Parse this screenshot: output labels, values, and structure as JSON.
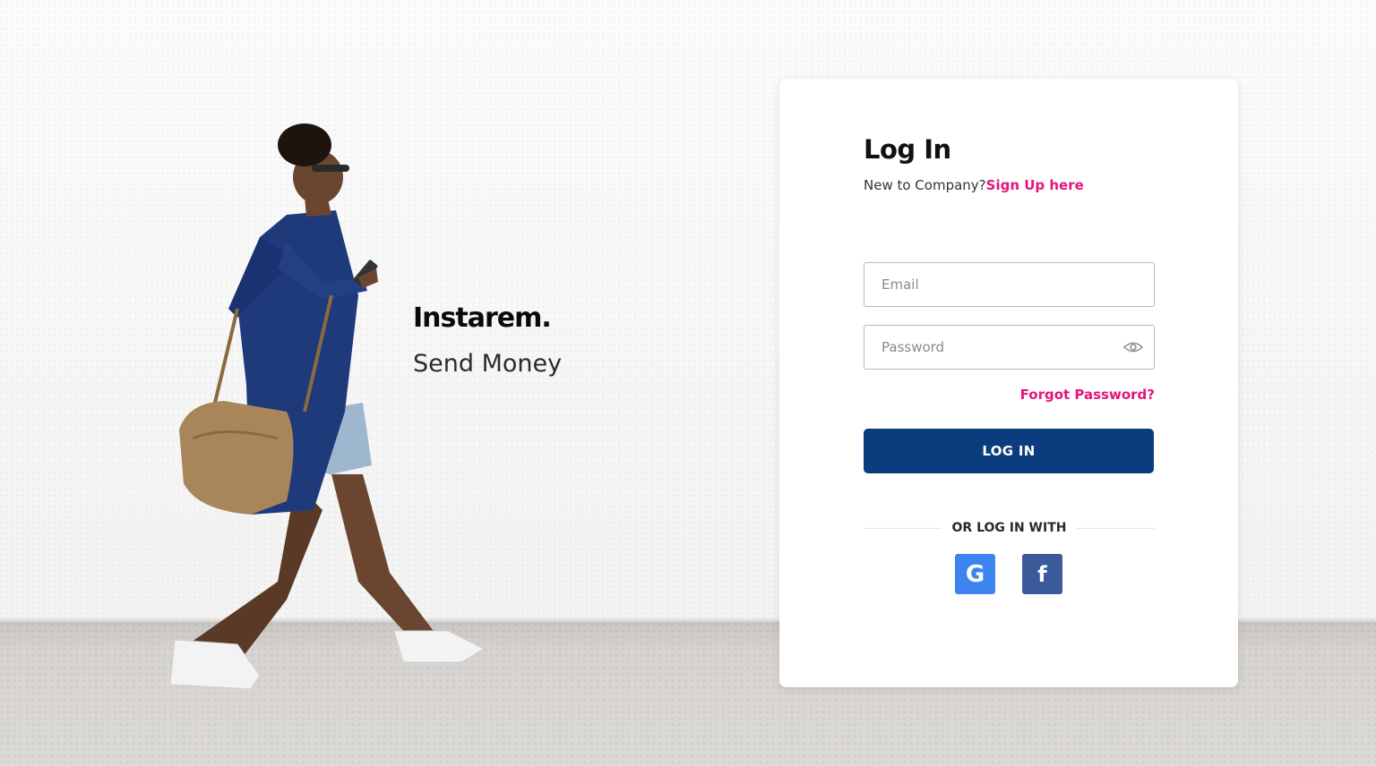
{
  "brand": {
    "logo_text": "Instarem.",
    "tagline": "Send Money"
  },
  "login": {
    "title": "Log In",
    "signup_prompt": "New to Company?",
    "signup_link": "Sign Up here",
    "email_placeholder": "Email",
    "email_value": "",
    "password_placeholder": "Password",
    "password_value": "",
    "forgot_password": "Forgot Password?",
    "login_button": "LOG IN",
    "social_divider": "OR LOG IN WITH",
    "social": [
      {
        "name": "google",
        "glyph": "G",
        "color": "#3e84f0"
      },
      {
        "name": "facebook",
        "glyph": "f",
        "color": "#3b5a9a"
      }
    ]
  },
  "colors": {
    "accent_pink": "#e4157c",
    "primary_blue": "#0b3d7e"
  }
}
